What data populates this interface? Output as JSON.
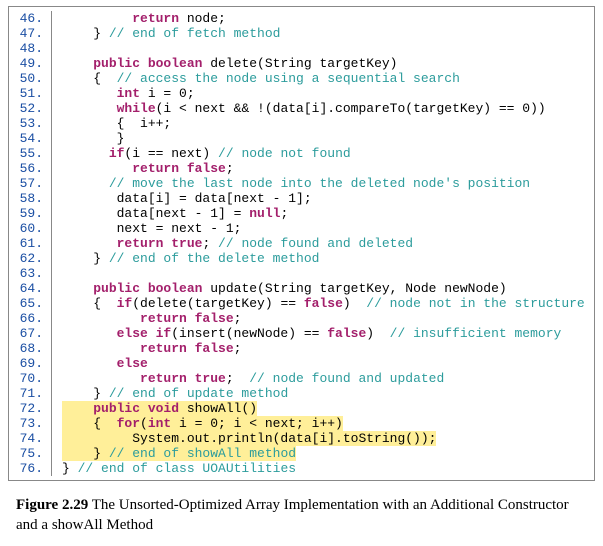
{
  "caption": {
    "label": "Figure 2.29",
    "text": " The Unsorted-Optimized Array Implementation with an Additional Constructor and a showAll Method"
  },
  "code": {
    "lines": [
      {
        "n": "46.",
        "segs": [
          {
            "t": "         "
          },
          {
            "t": "return",
            "c": "kw"
          },
          {
            "t": " node;"
          }
        ]
      },
      {
        "n": "47.",
        "segs": [
          {
            "t": "    } "
          },
          {
            "t": "// end of fetch method",
            "c": "cm"
          }
        ]
      },
      {
        "n": "48.",
        "segs": [
          {
            "t": ""
          }
        ]
      },
      {
        "n": "49.",
        "segs": [
          {
            "t": "    "
          },
          {
            "t": "public boolean",
            "c": "kw"
          },
          {
            "t": " delete(String targetKey)"
          }
        ]
      },
      {
        "n": "50.",
        "segs": [
          {
            "t": "    {  "
          },
          {
            "t": "// access the node using a sequential search",
            "c": "cm"
          }
        ]
      },
      {
        "n": "51.",
        "segs": [
          {
            "t": "       "
          },
          {
            "t": "int",
            "c": "kw"
          },
          {
            "t": " i = 0;"
          }
        ]
      },
      {
        "n": "52.",
        "segs": [
          {
            "t": "       "
          },
          {
            "t": "while",
            "c": "kw"
          },
          {
            "t": "(i < next && !(data[i].compareTo(targetKey) == 0))"
          }
        ]
      },
      {
        "n": "53.",
        "segs": [
          {
            "t": "       {  i++;"
          }
        ]
      },
      {
        "n": "54.",
        "segs": [
          {
            "t": "       }"
          }
        ]
      },
      {
        "n": "55.",
        "segs": [
          {
            "t": "      "
          },
          {
            "t": "if",
            "c": "kw"
          },
          {
            "t": "(i == next) "
          },
          {
            "t": "// node not found",
            "c": "cm"
          }
        ]
      },
      {
        "n": "56.",
        "segs": [
          {
            "t": "         "
          },
          {
            "t": "return false",
            "c": "kw"
          },
          {
            "t": ";"
          }
        ]
      },
      {
        "n": "57.",
        "segs": [
          {
            "t": "      "
          },
          {
            "t": "// move the last node into the deleted node's position",
            "c": "cm"
          }
        ]
      },
      {
        "n": "58.",
        "segs": [
          {
            "t": "       data[i] = data[next - 1];"
          }
        ]
      },
      {
        "n": "59.",
        "segs": [
          {
            "t": "       data[next - 1] = "
          },
          {
            "t": "null",
            "c": "kw"
          },
          {
            "t": ";"
          }
        ]
      },
      {
        "n": "60.",
        "segs": [
          {
            "t": "       next = next - 1;"
          }
        ]
      },
      {
        "n": "61.",
        "segs": [
          {
            "t": "       "
          },
          {
            "t": "return true",
            "c": "kw"
          },
          {
            "t": "; "
          },
          {
            "t": "// node found and deleted",
            "c": "cm"
          }
        ]
      },
      {
        "n": "62.",
        "segs": [
          {
            "t": "    } "
          },
          {
            "t": "// end of the delete method",
            "c": "cm"
          }
        ]
      },
      {
        "n": "63.",
        "segs": [
          {
            "t": ""
          }
        ]
      },
      {
        "n": "64.",
        "segs": [
          {
            "t": "    "
          },
          {
            "t": "public boolean",
            "c": "kw"
          },
          {
            "t": " update(String targetKey, Node newNode)"
          }
        ]
      },
      {
        "n": "65.",
        "segs": [
          {
            "t": "    {  "
          },
          {
            "t": "if",
            "c": "kw"
          },
          {
            "t": "(delete(targetKey) == "
          },
          {
            "t": "false",
            "c": "kw"
          },
          {
            "t": ")  "
          },
          {
            "t": "// node not in the structure",
            "c": "cm"
          }
        ]
      },
      {
        "n": "66.",
        "segs": [
          {
            "t": "          "
          },
          {
            "t": "return false",
            "c": "kw"
          },
          {
            "t": ";"
          }
        ]
      },
      {
        "n": "67.",
        "segs": [
          {
            "t": "       "
          },
          {
            "t": "else if",
            "c": "kw"
          },
          {
            "t": "(insert(newNode) == "
          },
          {
            "t": "false",
            "c": "kw"
          },
          {
            "t": ")  "
          },
          {
            "t": "// insufficient memory",
            "c": "cm"
          }
        ]
      },
      {
        "n": "68.",
        "segs": [
          {
            "t": "          "
          },
          {
            "t": "return false",
            "c": "kw"
          },
          {
            "t": ";"
          }
        ]
      },
      {
        "n": "69.",
        "segs": [
          {
            "t": "       "
          },
          {
            "t": "else",
            "c": "kw"
          }
        ]
      },
      {
        "n": "70.",
        "segs": [
          {
            "t": "          "
          },
          {
            "t": "return true",
            "c": "kw"
          },
          {
            "t": ";  "
          },
          {
            "t": "// node found and updated",
            "c": "cm"
          }
        ]
      },
      {
        "n": "71.",
        "segs": [
          {
            "t": "    } "
          },
          {
            "t": "// end of update method",
            "c": "cm"
          }
        ]
      },
      {
        "n": "72.",
        "hl": true,
        "segs": [
          {
            "t": "    "
          },
          {
            "t": "public void",
            "c": "kw"
          },
          {
            "t": " showAll()"
          }
        ]
      },
      {
        "n": "73.",
        "hl": true,
        "segs": [
          {
            "t": "    {  "
          },
          {
            "t": "for",
            "c": "kw"
          },
          {
            "t": "("
          },
          {
            "t": "int",
            "c": "kw"
          },
          {
            "t": " i = 0; i < next; i++)"
          }
        ]
      },
      {
        "n": "74.",
        "hl": true,
        "segs": [
          {
            "t": "         System.out.println(data[i].toString());"
          }
        ]
      },
      {
        "n": "75.",
        "hl": true,
        "segs": [
          {
            "t": "    } "
          },
          {
            "t": "// end of showAll method",
            "c": "cm"
          }
        ]
      },
      {
        "n": "76.",
        "segs": [
          {
            "t": "} "
          },
          {
            "t": "// end of class UOAUtilities",
            "c": "cm"
          }
        ]
      }
    ]
  }
}
